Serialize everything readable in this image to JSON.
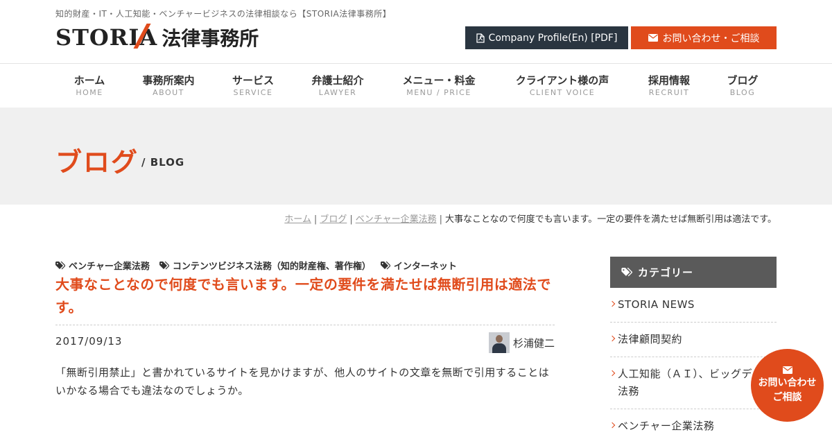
{
  "header": {
    "tagline": "知的財産・IT・人工知能・ベンチャービジネスの法律相談なら【STORIA法律事務所】",
    "logo_latin": "STORIA",
    "logo_jp": "法律事務所",
    "profile_button": "Company Profile(En) [PDF]",
    "contact_button": "お問い合わせ・ご相談"
  },
  "nav": [
    {
      "jp": "ホーム",
      "en": "HOME"
    },
    {
      "jp": "事務所案内",
      "en": "ABOUT"
    },
    {
      "jp": "サービス",
      "en": "SERVICE"
    },
    {
      "jp": "弁護士紹介",
      "en": "LAWYER"
    },
    {
      "jp": "メニュー・料金",
      "en": "MENU / PRICE"
    },
    {
      "jp": "クライアント様の声",
      "en": "CLIENT VOICE"
    },
    {
      "jp": "採用情報",
      "en": "RECRUIT"
    },
    {
      "jp": "ブログ",
      "en": "BLOG"
    }
  ],
  "banner": {
    "title": "ブログ",
    "subtitle": "/ BLOG"
  },
  "breadcrumb": {
    "home": "ホーム",
    "blog": "ブログ",
    "category": "ベンチャー企業法務",
    "current": "大事なことなので何度でも言います。一定の要件を満たせば無断引用は適法です。"
  },
  "article": {
    "tags": [
      "ベンチャー企業法務",
      "コンテンツビジネス法務（知的財産権、著作権）",
      "インターネット"
    ],
    "title": "大事なことなので何度でも言います。一定の要件を満たせば無断引用は適法です。",
    "date": "2017/09/13",
    "author": "杉浦健二",
    "body": "「無断引用禁止」と書かれているサイトを見かけますが、他人のサイトの文章を無断で引用することはいかなる場合でも違法なのでしょうか。"
  },
  "sidebar": {
    "heading": "カテゴリー",
    "items": [
      "STORIA NEWS",
      "法律顧問契約",
      "人工知能（ＡＩ）、ビッグデータ法務",
      "ベンチャー企業法務"
    ]
  },
  "float_contact": {
    "line1": "お問い合わせ",
    "line2": "ご相談"
  },
  "colors": {
    "accent": "#e04b1c",
    "dark": "#2a3540",
    "sidebar_head": "#5a5a5a"
  }
}
